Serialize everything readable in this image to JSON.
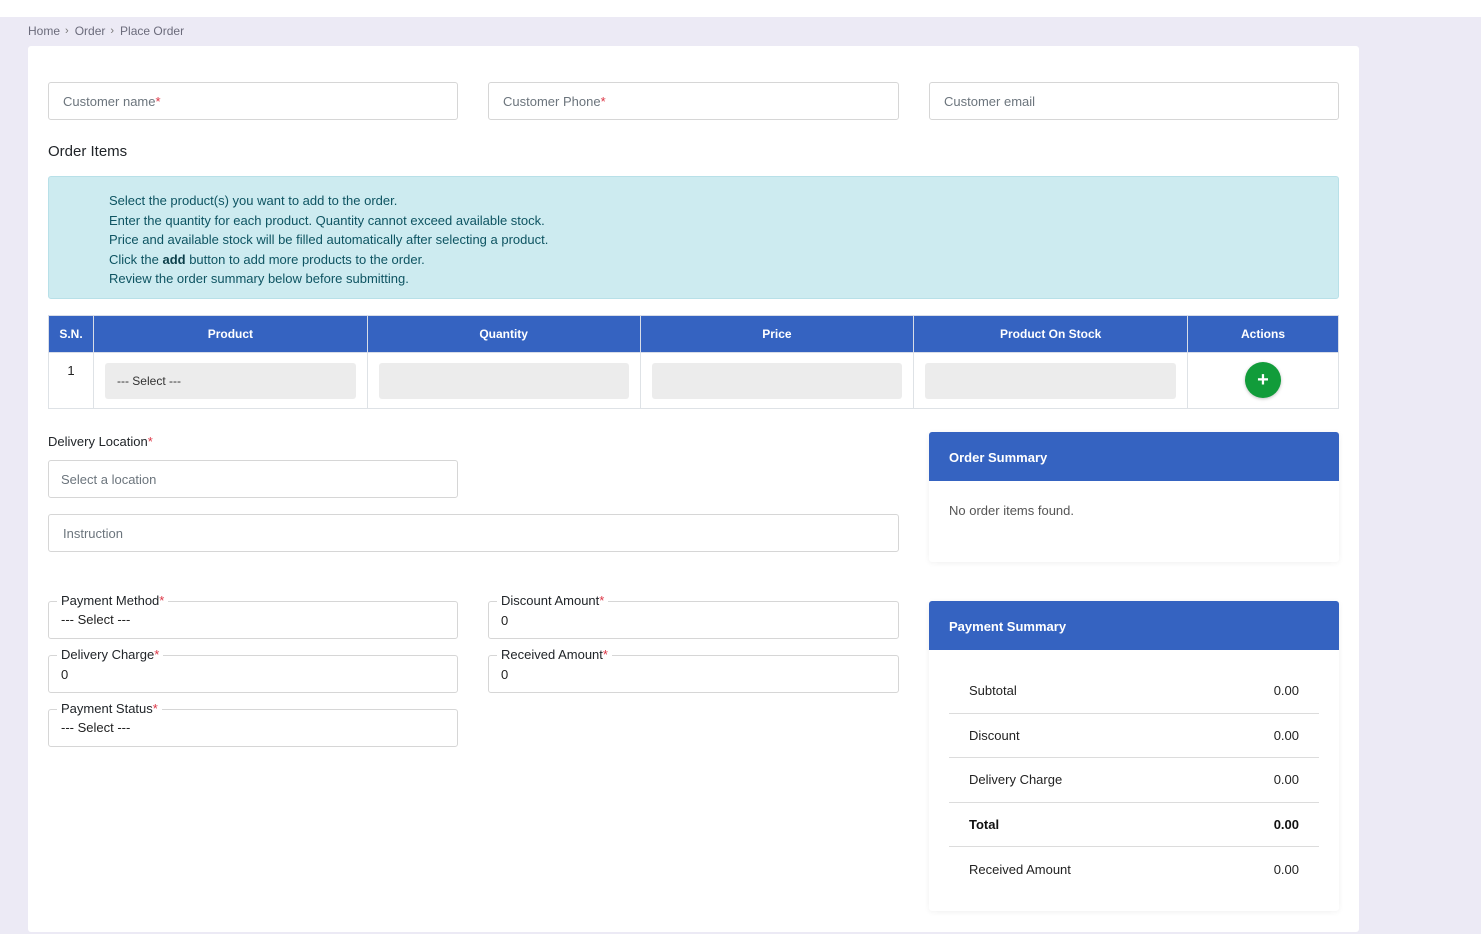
{
  "breadcrumb": [
    "Home",
    "Order",
    "Place Order"
  ],
  "customer": {
    "name_placeholder": "Customer name",
    "phone_placeholder": "Customer Phone",
    "email_placeholder": "Customer email",
    "required_mark": "*"
  },
  "order_items": {
    "title": "Order Items",
    "instructions": {
      "line1": "Select the product(s) you want to add to the order.",
      "line2": "Enter the quantity for each product. Quantity cannot exceed available stock.",
      "line3": "Price and available stock will be filled automatically after selecting a product.",
      "line4_pre": "Click the ",
      "line4_bold": "add",
      "line4_post": " button to add more products to the order.",
      "line5": "Review the order summary below before submitting."
    },
    "columns": [
      "S.N.",
      "Product",
      "Quantity",
      "Price",
      "Product On Stock",
      "Actions"
    ],
    "rows": [
      {
        "sn": "1",
        "product": "--- Select ---",
        "quantity": "",
        "price": "",
        "stock": ""
      }
    ],
    "add_button": "+"
  },
  "delivery": {
    "location_label": "Delivery Location",
    "location_placeholder": "Select a location",
    "instruction_placeholder": "Instruction"
  },
  "payment": {
    "method_label": "Payment Method",
    "method_value": "--- Select ---",
    "discount_label": "Discount Amount",
    "discount_value": "0",
    "delivery_charge_label": "Delivery Charge",
    "delivery_charge_value": "0",
    "received_label": "Received Amount",
    "received_value": "0",
    "status_label": "Payment Status",
    "status_value": "--- Select ---"
  },
  "order_summary": {
    "title": "Order Summary",
    "empty_text": "No order items found."
  },
  "payment_summary": {
    "title": "Payment Summary",
    "rows": [
      {
        "label": "Subtotal",
        "value": "0.00"
      },
      {
        "label": "Discount",
        "value": "0.00"
      },
      {
        "label": "Delivery Charge",
        "value": "0.00"
      },
      {
        "label": "Total",
        "value": "0.00"
      },
      {
        "label": "Received Amount",
        "value": "0.00"
      }
    ]
  },
  "colors": {
    "header_blue": "#3563c1",
    "add_green": "#119c3a",
    "alert_bg": "#cdebf0",
    "required_red": "#dc3545"
  }
}
